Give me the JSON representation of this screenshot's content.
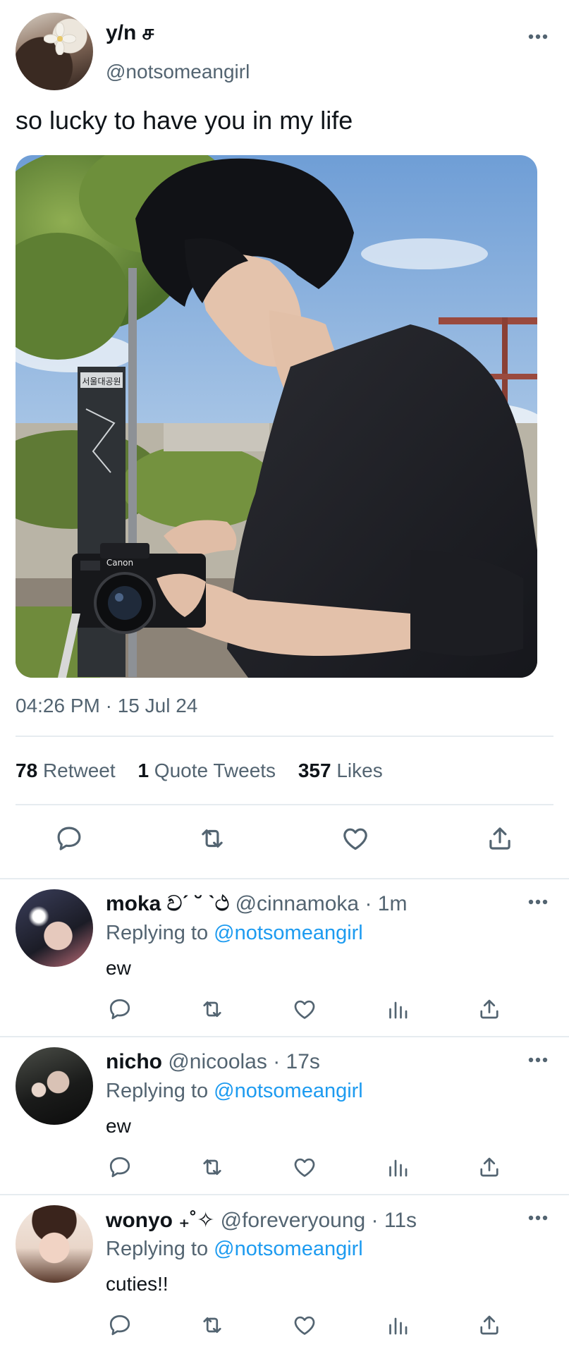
{
  "tweet": {
    "author_name": "y/n ச",
    "author_handle": "@notsomeangirl",
    "text": "so lucky to have you in my life",
    "timestamp": "04:26 PM · 15 Jul 24",
    "photo_text": {
      "camera_brand": "Canon",
      "sign_title": "서울대공원"
    },
    "stats": {
      "retweets": "78",
      "retweets_label": "Retweet",
      "quotes": "1",
      "quotes_label": "Quote Tweets",
      "likes": "357",
      "likes_label": "Likes"
    },
    "actions": [
      "reply-icon",
      "retweet-icon",
      "like-icon",
      "share-icon"
    ]
  },
  "replies": [
    {
      "name": "moka වˊ ˘ ˋථ",
      "handle": "@cinnamoka",
      "time": "1m",
      "replying_prefix": "Replying to",
      "replying_to": "@notsomeangirl",
      "text": "ew"
    },
    {
      "name": "nicho",
      "handle": "@nicoolas",
      "time": "17s",
      "replying_prefix": "Replying to",
      "replying_to": "@notsomeangirl",
      "text": "ew"
    },
    {
      "name": "wonyo ₊˚✧",
      "handle": "@foreveryoung",
      "time": "11s",
      "replying_prefix": "Replying to",
      "replying_to": "@notsomeangirl",
      "text": "cuties!!"
    }
  ],
  "reply_actions": [
    "reply-icon",
    "retweet-icon",
    "like-icon",
    "analytics-icon",
    "share-icon"
  ],
  "colors": {
    "text": "#0f1419",
    "secondary": "#536471",
    "link": "#1d9bf0",
    "divider": "#e6ecf0"
  }
}
